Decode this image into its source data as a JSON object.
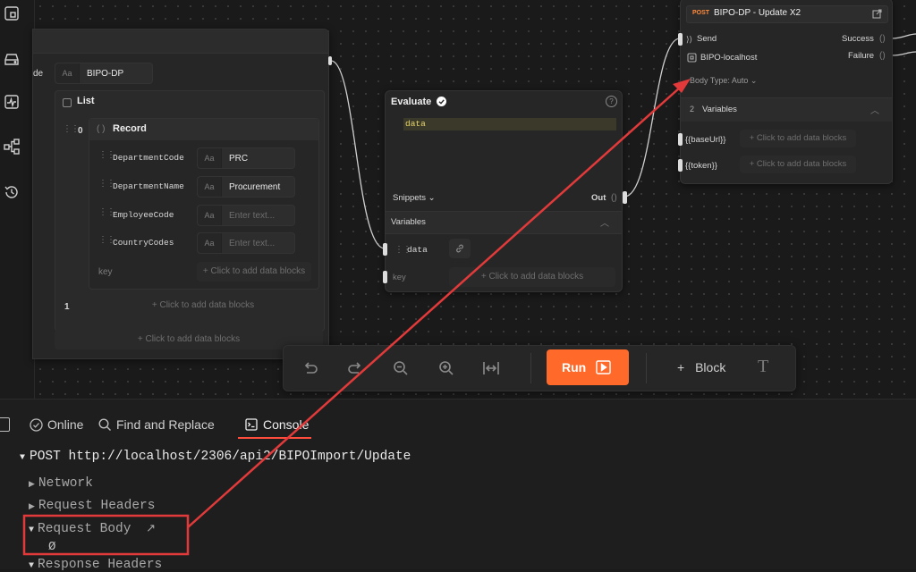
{
  "sidebar_icons": [
    "frame-icon",
    "drive-icon",
    "activity-icon",
    "share-graph-icon",
    "history-icon"
  ],
  "list_node": {
    "partial_label": "de",
    "name_value": "BIPO-DP",
    "list_title": "List",
    "index_0": "0",
    "record_title": "Record",
    "fields": [
      {
        "key": "DepartmentCode",
        "value": "PRC",
        "placeholder": ""
      },
      {
        "key": "DepartmentName",
        "value": "Procurement",
        "placeholder": ""
      },
      {
        "key": "EmployeeCode",
        "value": "",
        "placeholder": "Enter text..."
      },
      {
        "key": "CountryCodes",
        "value": "",
        "placeholder": "Enter text..."
      }
    ],
    "key_placeholder": "key",
    "record_add": "+ Click to add data blocks",
    "index_1": "1",
    "item1_add": "+ Click to add data blocks",
    "list_add": "+ Click to add data blocks",
    "aa": "Aa"
  },
  "evaluate_node": {
    "title": "Evaluate",
    "code": "data",
    "snippets": "Snippets",
    "out": "Out",
    "variables": "Variables",
    "var_name": "data",
    "key_placeholder": "key",
    "add": "+ Click to add data blocks",
    "help": "?"
  },
  "request_node": {
    "method": "POST",
    "title": "BIPO-DP - Update X2",
    "send": "Send",
    "success": "Success",
    "failure": "Failure",
    "env": "BIPO-localhost",
    "body_type": "Body Type: Auto",
    "var_count": "2",
    "variables": "Variables",
    "vars": [
      {
        "name": "{{baseUrl}}",
        "add": "+ Click to add data blocks"
      },
      {
        "name": "{{token}}",
        "add": "+ Click to add data blocks"
      }
    ]
  },
  "toolbar": {
    "run": "Run",
    "block": "Block",
    "plus": "+"
  },
  "bottom_tabs": {
    "online": "Online",
    "find": "Find and Replace",
    "console": "Console"
  },
  "console": {
    "request_line": "POST http://localhost/2306/api2/BIPOImport/Update",
    "network": "Network",
    "request_headers": "Request Headers",
    "request_body": "Request Body",
    "body_value": "Ø",
    "response_headers": "Response Headers"
  },
  "colors": {
    "accent": "#ff6a2a",
    "annotation": "#e23a3a",
    "success_check": "#ffffff",
    "method": "#ff8a3d"
  }
}
